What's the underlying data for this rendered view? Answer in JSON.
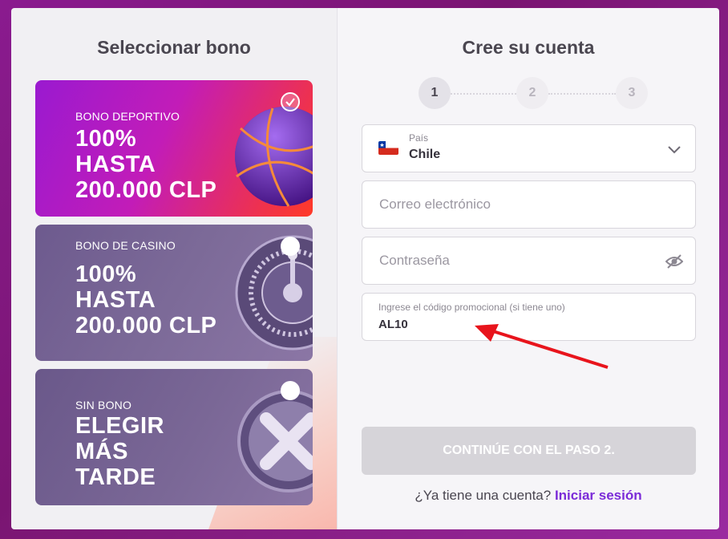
{
  "left": {
    "title": "Seleccionar bono",
    "bonuses": [
      {
        "label": "BONO DEPORTIVO",
        "headline": "100%\nHASTA\n200.000 CLP",
        "selected": true,
        "icon": "basketball-icon"
      },
      {
        "label": "BONO DE CASINO",
        "headline": "100%\nHASTA\n200.000 CLP",
        "selected": false,
        "icon": "roulette-icon"
      },
      {
        "label": "SIN BONO",
        "headline": "ELEGIR\nMÁS\nTARDE",
        "selected": false,
        "icon": "x-coin-icon"
      }
    ]
  },
  "right": {
    "title": "Cree su cuenta",
    "steps": [
      "1",
      "2",
      "3"
    ],
    "active_step": 1,
    "country": {
      "label": "País",
      "value": "Chile",
      "flag_icon": "chile-flag-icon"
    },
    "email": {
      "placeholder": "Correo electrónico"
    },
    "password": {
      "placeholder": "Contraseña"
    },
    "promo": {
      "label": "Ingrese el código promocional (si tiene uno)",
      "value": "AL10"
    },
    "continue_label": "CONTINÚE CON EL PASO 2.",
    "login_prompt": "¿Ya tiene una cuenta?",
    "login_link": "Iniciar sesión"
  },
  "colors": {
    "accent": "#7b2bd8",
    "annotation_arrow": "#e8141c",
    "disabled_button": "#d6d4d9"
  }
}
